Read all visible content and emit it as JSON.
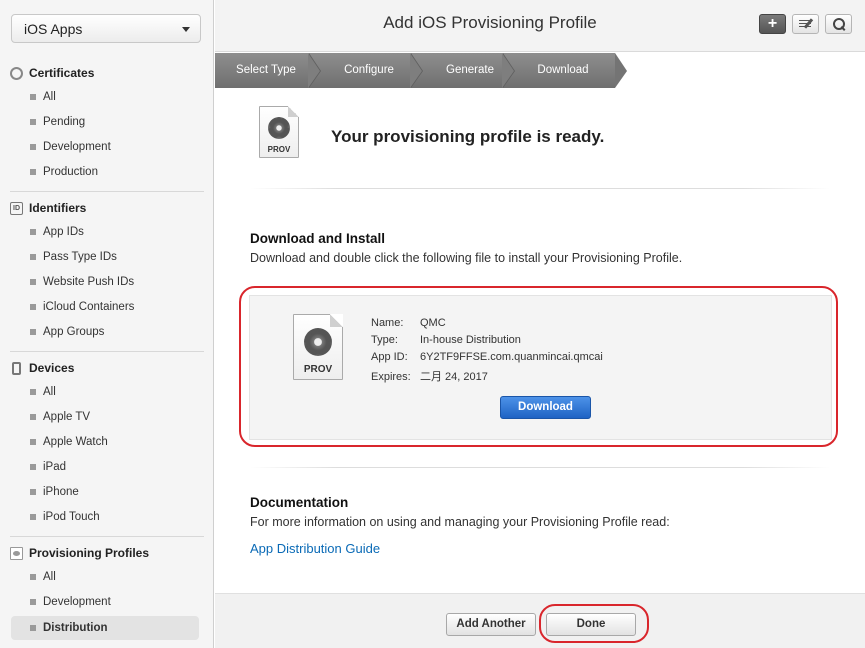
{
  "sidebar": {
    "app_selector": "iOS Apps",
    "sections": [
      {
        "title": "Certificates",
        "items": [
          "All",
          "Pending",
          "Development",
          "Production"
        ]
      },
      {
        "title": "Identifiers",
        "items": [
          "App IDs",
          "Pass Type IDs",
          "Website Push IDs",
          "iCloud Containers",
          "App Groups"
        ]
      },
      {
        "title": "Devices",
        "items": [
          "All",
          "Apple TV",
          "Apple Watch",
          "iPad",
          "iPhone",
          "iPod Touch"
        ]
      },
      {
        "title": "Provisioning Profiles",
        "items": [
          "All",
          "Development",
          "Distribution"
        ]
      }
    ],
    "active_item": "Distribution"
  },
  "header": {
    "title": "Add iOS Provisioning Profile",
    "add_icon": "plus-icon",
    "edit_icon": "edit-icon",
    "search_icon": "search-icon"
  },
  "steps": [
    "Select Type",
    "Configure",
    "Generate",
    "Download"
  ],
  "main": {
    "icon_label": "PROV",
    "ready_title": "Your provisioning profile is ready.",
    "download_section": {
      "title": "Download and Install",
      "description": "Download and double click the following file to install your Provisioning Profile."
    },
    "profile": {
      "name_label": "Name:",
      "name": "QMC",
      "type_label": "Type:",
      "type": "In-house Distribution",
      "appid_label": "App ID:",
      "app_id": "6Y2TF9FFSE.com.quanmincai.qmcai",
      "expires_label": "Expires:",
      "expires": "二月 24, 2017",
      "download_button": "Download"
    },
    "documentation": {
      "title": "Documentation",
      "description": "For more information on using and managing your Provisioning Profile read:",
      "link": "App Distribution Guide"
    }
  },
  "footer": {
    "add_another": "Add Another",
    "done": "Done"
  },
  "colors": {
    "highlight": "#d9262c",
    "primary_button": "#1e63c4",
    "link": "#0a6ab6"
  }
}
